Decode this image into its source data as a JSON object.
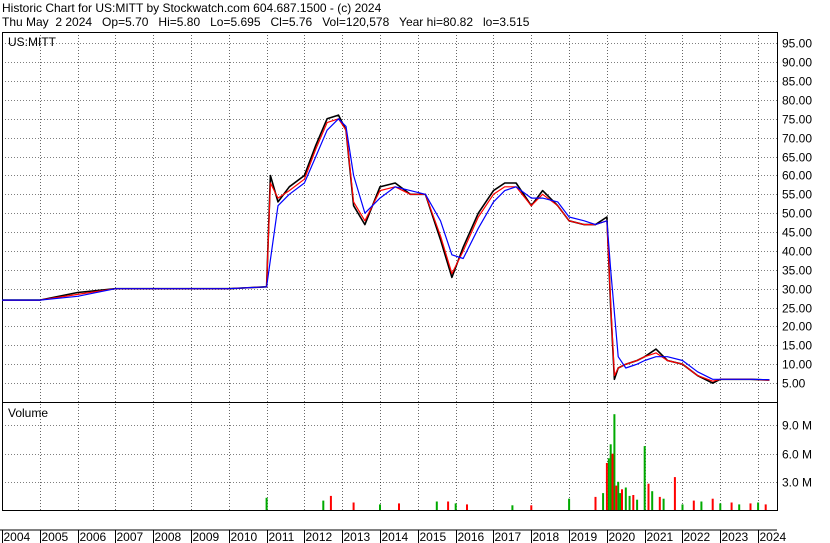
{
  "header": {
    "line1": "Historic Chart for US:MITT by Stockwatch.com 604.687.1500 - (c) 2024",
    "line2": "Thu May  2 2024   Op=5.70   Hi=5.80   Lo=5.695   Cl=5.76   Vol=120,578   Year hi=80.82   lo=3.515"
  },
  "colors": {
    "price": "#000000",
    "ma_short": "#ff0000",
    "ma_long": "#0000ff",
    "volume_up": "#00aa00",
    "volume_down": "#ff0000",
    "grid": "#000000"
  },
  "chart_data": [
    {
      "type": "line",
      "panel_label": "US:MITT",
      "y_ticks": [
        "95.00",
        "90.00",
        "85.00",
        "80.00",
        "75.00",
        "70.00",
        "65.00",
        "60.00",
        "55.00",
        "50.00",
        "45.00",
        "40.00",
        "35.00",
        "30.00",
        "25.00",
        "20.00",
        "15.00",
        "10.00",
        "5.00"
      ],
      "ylim": [
        0,
        98
      ],
      "grid": true,
      "series": [
        {
          "color": "#000000",
          "x": [
            2004.0,
            2005.0,
            2006.0,
            2007.0,
            2008.0,
            2009.0,
            2010.0,
            2011.0,
            2011.1,
            2011.3,
            2011.6,
            2012.0,
            2012.3,
            2012.6,
            2012.9,
            2013.1,
            2013.3,
            2013.6,
            2014.0,
            2014.4,
            2014.8,
            2015.2,
            2015.6,
            2015.9,
            2016.2,
            2016.6,
            2017.0,
            2017.3,
            2017.6,
            2018.0,
            2018.3,
            2018.7,
            2019.0,
            2019.4,
            2019.7,
            2020.0,
            2020.1,
            2020.2,
            2020.3,
            2020.5,
            2020.8,
            2021.0,
            2021.3,
            2021.6,
            2022.0,
            2022.4,
            2022.8,
            2023.0,
            2023.4,
            2023.8,
            2024.3
          ],
          "y": [
            27,
            27,
            29,
            30,
            30,
            30,
            30,
            30.5,
            60,
            53,
            57,
            60,
            68,
            75,
            76,
            72,
            52,
            47,
            57,
            58,
            55,
            55,
            43,
            33,
            41,
            50,
            56,
            58,
            58,
            52,
            56,
            52,
            48,
            47,
            47,
            49,
            25,
            6,
            9,
            10,
            11,
            12,
            14,
            11,
            10,
            7,
            5,
            6,
            6,
            6,
            5.8
          ]
        },
        {
          "color": "#ff0000",
          "x": [
            2004.0,
            2005.0,
            2006.0,
            2007.0,
            2008.0,
            2009.0,
            2010.0,
            2011.0,
            2011.1,
            2011.3,
            2011.6,
            2012.0,
            2012.3,
            2012.6,
            2012.9,
            2013.1,
            2013.3,
            2013.6,
            2014.0,
            2014.4,
            2014.8,
            2015.2,
            2015.6,
            2015.9,
            2016.2,
            2016.6,
            2017.0,
            2017.3,
            2017.6,
            2018.0,
            2018.3,
            2018.7,
            2019.0,
            2019.4,
            2019.7,
            2020.0,
            2020.1,
            2020.2,
            2020.3,
            2020.5,
            2020.8,
            2021.0,
            2021.3,
            2021.6,
            2022.0,
            2022.4,
            2022.8,
            2023.0,
            2023.4,
            2023.8,
            2024.3
          ],
          "y": [
            27,
            27,
            28.5,
            30,
            30,
            30,
            30,
            30.5,
            58,
            54,
            56,
            59,
            67,
            74,
            75,
            72,
            53,
            48,
            56,
            57,
            55,
            55,
            44,
            34,
            40,
            49,
            55,
            57,
            57,
            52,
            55,
            52,
            48,
            47,
            47,
            48,
            26,
            7,
            9,
            10,
            11,
            12,
            13,
            11,
            10,
            7,
            5.5,
            6,
            6,
            6,
            5.8
          ]
        },
        {
          "color": "#0000ff",
          "x": [
            2004.0,
            2005.0,
            2006.0,
            2007.0,
            2008.0,
            2009.0,
            2010.0,
            2011.0,
            2011.3,
            2011.6,
            2012.0,
            2012.3,
            2012.6,
            2012.9,
            2013.1,
            2013.3,
            2013.6,
            2014.0,
            2014.4,
            2014.8,
            2015.2,
            2015.6,
            2015.9,
            2016.2,
            2016.6,
            2017.0,
            2017.3,
            2017.6,
            2018.0,
            2018.3,
            2018.7,
            2019.0,
            2019.4,
            2019.7,
            2020.0,
            2020.1,
            2020.3,
            2020.5,
            2020.8,
            2021.0,
            2021.3,
            2021.6,
            2022.0,
            2022.4,
            2022.8,
            2023.0,
            2023.4,
            2023.8,
            2024.3
          ],
          "y": [
            27,
            27,
            28,
            30,
            30,
            30,
            30,
            30.5,
            52,
            55,
            58,
            65,
            72,
            75,
            73,
            60,
            50,
            54,
            57,
            56,
            55,
            48,
            39,
            38,
            46,
            53,
            56,
            57,
            54,
            54,
            53,
            49,
            48,
            47,
            48,
            35,
            12,
            9,
            10,
            11,
            12,
            12,
            11,
            8,
            6,
            6,
            6,
            6,
            5.9
          ]
        }
      ]
    },
    {
      "type": "bar",
      "panel_label": "Volume",
      "y_ticks": [
        "9.0 M",
        "6.0 M",
        "3.0 M"
      ],
      "ylim": [
        0,
        11.5
      ],
      "grid": true,
      "series": [
        {
          "name": "",
          "color": "#00aa00",
          "x": [
            2011.0,
            2012.5,
            2014.0,
            2015.5,
            2016.0,
            2017.5,
            2019.0,
            2019.9,
            2020.05,
            2020.1,
            2020.2,
            2020.3,
            2020.35,
            2020.5,
            2020.6,
            2020.8,
            2021.0,
            2021.2,
            2021.5,
            2022.0,
            2022.5,
            2023.0,
            2023.5,
            2024.0
          ],
          "y": [
            1.3,
            1.0,
            0.6,
            0.9,
            0.7,
            0.5,
            1.2,
            1.8,
            5.5,
            7.0,
            10.2,
            3.0,
            1.8,
            2.4,
            1.5,
            1.1,
            6.8,
            2.0,
            1.2,
            0.6,
            0.9,
            0.7,
            0.6,
            0.8
          ]
        },
        {
          "name": "",
          "color": "#ff0000",
          "x": [
            2012.7,
            2013.3,
            2014.5,
            2015.8,
            2016.3,
            2018.0,
            2019.7,
            2020.0,
            2020.15,
            2020.25,
            2020.4,
            2020.7,
            2021.1,
            2021.4,
            2021.8,
            2022.3,
            2022.8,
            2023.3,
            2023.8,
            2024.2
          ],
          "y": [
            1.5,
            0.8,
            0.7,
            0.9,
            0.6,
            0.5,
            1.4,
            5.0,
            6.0,
            2.6,
            2.2,
            1.6,
            2.8,
            1.4,
            3.5,
            1.0,
            1.2,
            0.8,
            0.7,
            0.6
          ]
        }
      ]
    },
    {
      "type": "axis",
      "x_ticks": [
        "2004",
        "2005",
        "2006",
        "2007",
        "2008",
        "2009",
        "2010",
        "2011",
        "2012",
        "2013",
        "2014",
        "2015",
        "2016",
        "2017",
        "2018",
        "2019",
        "2020",
        "2021",
        "2022",
        "2023",
        "2024"
      ]
    }
  ]
}
